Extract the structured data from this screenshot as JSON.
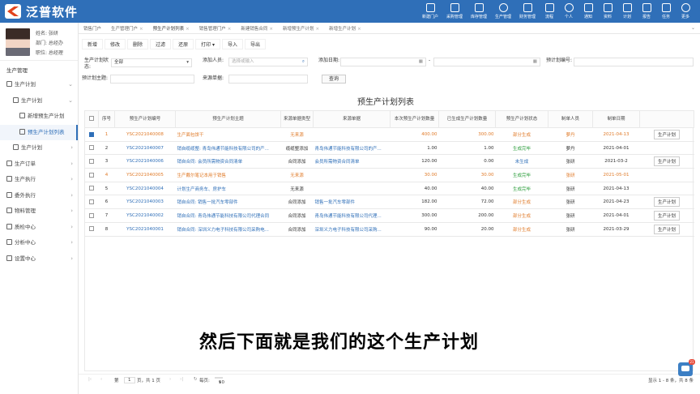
{
  "app": {
    "title": "泛普软件"
  },
  "topnav": [
    {
      "label": "新建门户",
      "icon": "dashboard-icon"
    },
    {
      "label": "采购管理",
      "icon": "cart-icon"
    },
    {
      "label": "库存管理",
      "icon": "warehouse-icon"
    },
    {
      "label": "生产管理",
      "icon": "gears-icon"
    },
    {
      "label": "财务管理",
      "icon": "money-icon"
    },
    {
      "label": "流程",
      "icon": "flow-icon"
    },
    {
      "label": "个人",
      "icon": "person-icon"
    },
    {
      "label": "通知",
      "icon": "bell-icon"
    },
    {
      "label": "资料",
      "icon": "book-icon"
    },
    {
      "label": "计划",
      "icon": "calendar-icon"
    },
    {
      "label": "报告",
      "icon": "report-icon"
    },
    {
      "label": "任务",
      "icon": "task-icon"
    },
    {
      "label": "更多",
      "icon": "more-icon"
    }
  ],
  "profile": {
    "name": "姓名: 张研",
    "dept": "部门: 总经办",
    "position": "职位: 总经理"
  },
  "sidebar": {
    "section": "生产管理",
    "items": [
      {
        "label": "生产计划",
        "arrow": "⌄"
      },
      {
        "label": "生产计划",
        "arrow": "⌄"
      },
      {
        "label": "新增预生产计划"
      },
      {
        "label": "预生产计划列表"
      },
      {
        "label": "生产计划",
        "arrow": "›"
      },
      {
        "label": "生产订单",
        "arrow": "›"
      },
      {
        "label": "生产执行",
        "arrow": "›"
      },
      {
        "label": "委外执行",
        "arrow": "›"
      },
      {
        "label": "物料管理",
        "arrow": "›"
      },
      {
        "label": "质检中心",
        "arrow": "›"
      },
      {
        "label": "分析中心",
        "arrow": "›"
      },
      {
        "label": "设置中心",
        "arrow": "›"
      }
    ]
  },
  "tabs": [
    {
      "label": "销售门户"
    },
    {
      "label": "生产管理门户"
    },
    {
      "label": "预生产计划列表"
    },
    {
      "label": "销售管理门户"
    },
    {
      "label": "新建销售合同"
    },
    {
      "label": "新增预生产计划"
    },
    {
      "label": "新增生产计划"
    }
  ],
  "toolbar": [
    "新增",
    "修改",
    "删除",
    "过滤",
    "还原",
    "打印 ▾",
    "导入",
    "导出"
  ],
  "filters": {
    "status_label": "生产计划状态:",
    "status_value": "全部",
    "creator_label": "添加人员:",
    "creator_placeholder": "选择或输入",
    "date_label": "添加日期:",
    "date_sep": "-",
    "plan_no_label": "预计划编号:",
    "topic_label": "预计划主题:",
    "source_label": "来源单据:",
    "search_label": "查询"
  },
  "grid": {
    "title": "预生产计划列表",
    "columns": [
      "",
      "序号",
      "预生产计划编号",
      "预生产计划主题",
      "来源单据类型",
      "来源单据",
      "本次预生产计划数量",
      "已生成生产计划数量",
      "预生产计划状态",
      "制单人员",
      "制单日期",
      ""
    ],
    "rows": [
      {
        "checked": true,
        "seq": "1",
        "no": "YSC2021040008",
        "topic": "生产面包饼干",
        "src_type": "无来源",
        "src": "",
        "qty": "400.00",
        "gen": "300.00",
        "status": "部分生成",
        "maker": "萝丹",
        "date": "2021-04-13",
        "action": "生产计划",
        "hl": true
      },
      {
        "checked": false,
        "seq": "2",
        "no": "YSC2021040007",
        "topic": "销自缆缆整: 青岛伟通节能科技有限公司的产...",
        "src_type": "缆缆整添加",
        "src": "青岛伟通节能科技有限公司的产...",
        "qty": "1.00",
        "gen": "1.00",
        "status": "生成完毕",
        "maker": "萝丹",
        "date": "2021-04-01",
        "action": ""
      },
      {
        "checked": false,
        "seq": "3",
        "no": "YSC2021040006",
        "topic": "销自合同: 会员所需物资合同清单",
        "src_type": "合同添加",
        "src": "会员所需物资合同清单",
        "qty": "120.00",
        "gen": "0.00",
        "status": "未生成",
        "maker": "张研",
        "date": "2021-03-2",
        "action": "生产计划"
      },
      {
        "checked": false,
        "seq": "4",
        "no": "YSC2021040005",
        "topic": "生产戴尔笔记本用于销售",
        "src_type": "无来源",
        "src": "",
        "qty": "30.00",
        "gen": "30.00",
        "status": "生成完毕",
        "maker": "张研",
        "date": "2021-05-01",
        "action": "",
        "hl": true
      },
      {
        "checked": false,
        "seq": "5",
        "no": "YSC2021040004",
        "topic": "计划生产商务车、房护车",
        "src_type": "无来源",
        "src": "",
        "qty": "40.00",
        "gen": "40.00",
        "status": "生成完毕",
        "maker": "张研",
        "date": "2021-04-13",
        "action": ""
      },
      {
        "checked": false,
        "seq": "6",
        "no": "YSC2021040003",
        "topic": "销自合同: 销售一批汽车零部件",
        "src_type": "合同添加",
        "src": "销售一批汽车零部件",
        "qty": "182.00",
        "gen": "72.00",
        "status": "部分生成",
        "maker": "张研",
        "date": "2021-04-23",
        "action": "生产计划"
      },
      {
        "checked": false,
        "seq": "7",
        "no": "YSC2021040002",
        "topic": "销自合同: 青岛伟通节能科技有限公司代理合同",
        "src_type": "合同添加",
        "src": "青岛伟通节能科技有限公司代理...",
        "qty": "300.00",
        "gen": "200.00",
        "status": "部分生成",
        "maker": "张研",
        "date": "2021-04-01",
        "action": "生产计划"
      },
      {
        "checked": false,
        "seq": "8",
        "no": "YSC2021040001",
        "topic": "销自合同: 深圳义力电子科技有限公司采购电...",
        "src_type": "合同添加",
        "src": "深圳义力电子科技有限公司采购...",
        "qty": "90.00",
        "gen": "20.00",
        "status": "部分生成",
        "maker": "张研",
        "date": "2021-03-29",
        "action": "生产计划"
      }
    ]
  },
  "subtitle": "然后下面就是我们的这个生产计划",
  "pager": {
    "first": "|‹",
    "prev": "‹",
    "page_prefix": "第",
    "page": "1",
    "page_suffix": "页，共 1 页",
    "next": "›",
    "last": "›|",
    "refresh": "↻",
    "size_label": "每页:",
    "size": "50",
    "info": "显示 1 - 8 条，共 8 条"
  },
  "chat": {
    "badge": "21"
  },
  "colors": {
    "primary": "#2f6fb8",
    "logo": "#e2431d",
    "orange": "#e07b2a",
    "green": "#2a9d3a"
  }
}
